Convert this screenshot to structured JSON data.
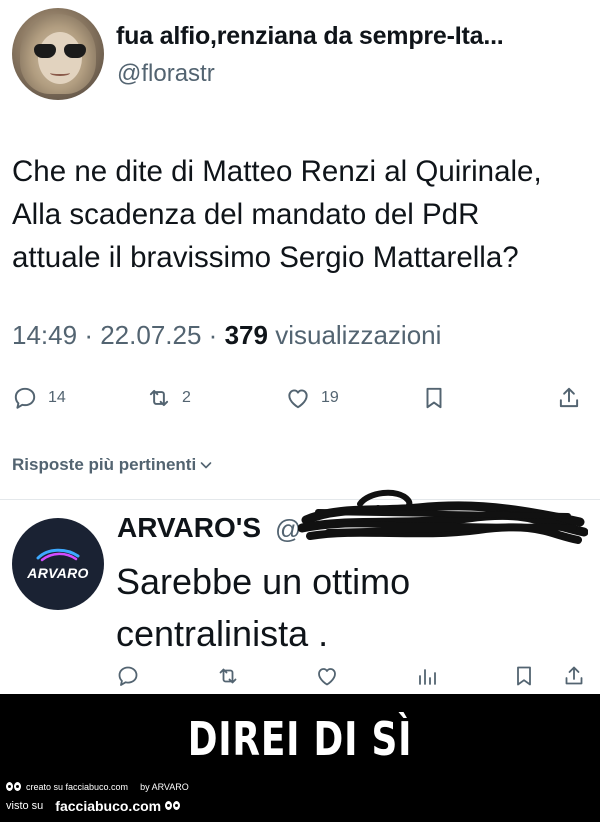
{
  "tweet": {
    "display_name": "fua alfio,renziana da sempre-Ita...",
    "handle": "@florastr",
    "text_lines": [
      "Che ne dite di Matteo Renzi al Quirinale,",
      "Alla scadenza del mandato del PdR",
      "attuale il bravissimo Sergio Mattarella?"
    ],
    "time": "14:49",
    "separator": "·",
    "date": "22.07.25",
    "views_count": "379",
    "views_label": "visualizzazioni",
    "replies": "14",
    "retweets": "2",
    "likes": "19"
  },
  "sort": {
    "label": "Risposte più pertinenti"
  },
  "reply": {
    "display_name": "ARVARO'S",
    "handle_prefix": "@",
    "avatar_text": "ARVARO",
    "text_lines": [
      "Sarebbe un ottimo",
      "centralinista ."
    ]
  },
  "banner": {
    "caption": "DIREI DI SÌ",
    "watermark_created": "creato su facciabuco.com",
    "watermark_by": "by ARVARO",
    "watermark_seen": "visto su",
    "watermark_site": "facciabuco.com"
  },
  "icons": {
    "reply": "reply-icon",
    "retweet": "retweet-icon",
    "like": "heart-icon",
    "bookmark": "bookmark-icon",
    "share": "share-icon",
    "views": "analytics-icon",
    "chevron": "chevron-down-icon"
  },
  "colors": {
    "text_primary": "#0f1419",
    "text_secondary": "#536471",
    "divider": "#e4e8eb",
    "banner_bg": "#000000",
    "avatar_bg": "#1a2233"
  }
}
